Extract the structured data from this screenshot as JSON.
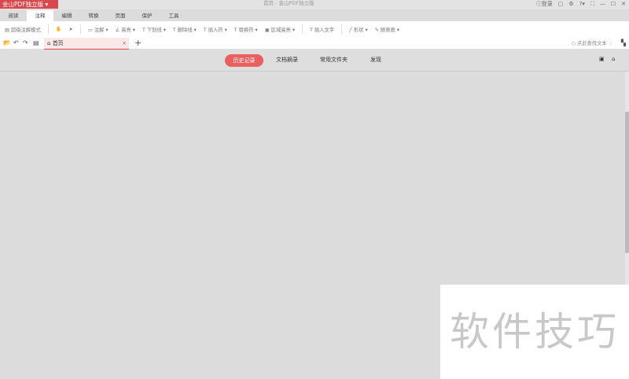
{
  "app": {
    "name": "金山PDF独立版",
    "window_title": "首页 - 金山PDF独立版",
    "login": "登录"
  },
  "menu_tabs": [
    "阅读",
    "注释",
    "编辑",
    "转换",
    "页面",
    "保护",
    "工具"
  ],
  "toolbar": [
    "超级注解模式",
    "注解",
    "高亮",
    "下划线",
    "删除线",
    "插入符",
    "替换符",
    "区域高亮",
    "插入文字",
    "形状",
    "随意画"
  ],
  "doc_tab": {
    "label": "首页",
    "close": "×",
    "add": "+"
  },
  "search_placeholder": "点此查找文本",
  "nav": {
    "items": [
      "历史记录",
      "文档摘录",
      "常用文件夹",
      "发现"
    ],
    "active": "历史记录"
  },
  "watermark": "软件技巧"
}
